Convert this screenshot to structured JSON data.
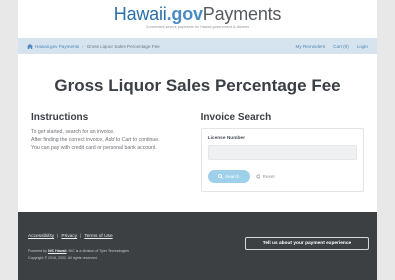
{
  "header": {
    "logo_brand": "Hawaii",
    "logo_gov": ".gov",
    "logo_payments": "Payments",
    "tagline": "Convenient secure payments for Hawaii government & citizens"
  },
  "nav": {
    "home": "Hawaii.gov Payments",
    "current": "Gross Liquor Sales Percentage Fee",
    "my_reminders": "My Reminders",
    "cart": "Cart (0)",
    "login": "Login"
  },
  "page_title": "Gross Liquor Sales Percentage Fee",
  "instructions": {
    "heading": "Instructions",
    "line1": "To get started, search for an invoice.",
    "line2_pre": "After finding the correct invoice, ",
    "line2_em": "Add to Cart",
    "line2_post": " to continue.",
    "line3": "You can pay with credit card or personal bank account."
  },
  "invoice_search": {
    "heading": "Invoice Search",
    "license_label": "License Number",
    "license_value": "",
    "search_label": "Search",
    "reset_label": "Reset"
  },
  "footer": {
    "accessibility": "Accessibility",
    "privacy": "Privacy",
    "terms": "Terms of Use",
    "sep": "|",
    "powered_pre": "Powered by ",
    "powered_org": "NIC Hawaii",
    "powered_post": ". NIC is a division of Tyler Technologies",
    "copyright": "Copyright © 2016, 2022. All rights reserved.",
    "feedback": "Tell us about your payment experience"
  },
  "colors": {
    "accent": "#2a6fa8",
    "nav_bg": "#d6e4ef",
    "footer_bg": "#3c4043",
    "search_button": "#9fd0ea"
  },
  "icons": [
    "home-icon",
    "search-icon",
    "reset-icon"
  ]
}
